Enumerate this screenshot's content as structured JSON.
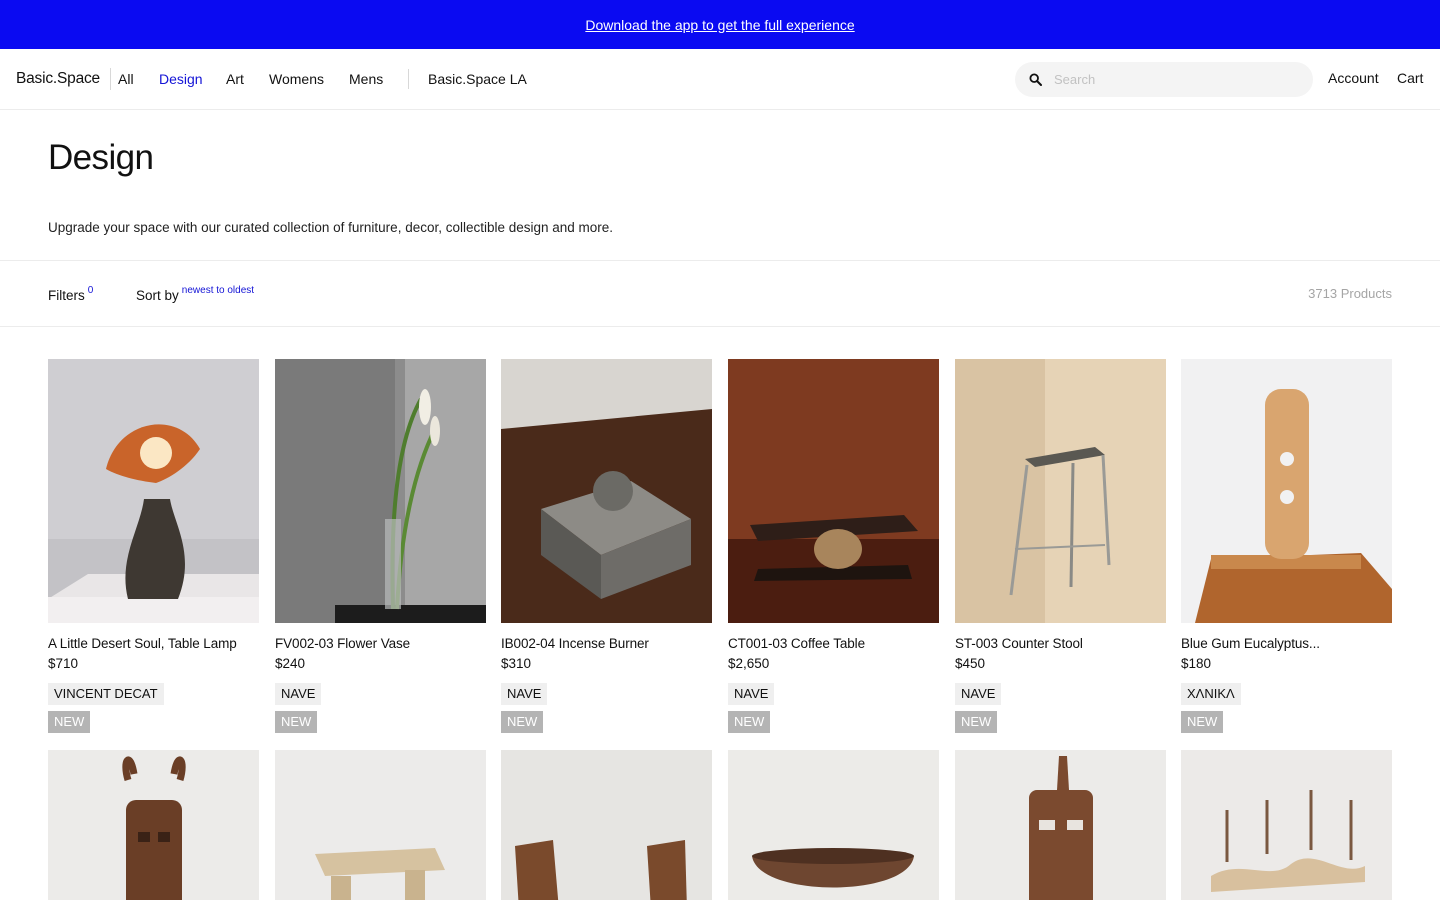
{
  "banner": {
    "text": "Download the app to get the full experience"
  },
  "nav": {
    "brand": "Basic.Space",
    "links": [
      {
        "label": "All",
        "active": false
      },
      {
        "label": "Design",
        "active": true
      },
      {
        "label": "Art",
        "active": false
      },
      {
        "label": "Womens",
        "active": false
      },
      {
        "label": "Mens",
        "active": false
      },
      {
        "label": "Basic.Space LA",
        "active": false
      }
    ],
    "search": {
      "placeholder": "Search",
      "value": ""
    },
    "account": "Account",
    "cart": "Cart"
  },
  "page": {
    "title": "Design",
    "description": "Upgrade your space with our curated collection of furniture, decor, collectible design and more."
  },
  "toolbar": {
    "filters_label": "Filters",
    "filters_count": "0",
    "sort_label": "Sort by",
    "sort_value": "newest to oldest",
    "product_count": "3713 Products"
  },
  "products": [
    {
      "name": "A Little Desert Soul, Table Lamp",
      "price": "$710",
      "brand": "VINCENT DECAT",
      "badge": "NEW",
      "image": "table-lamp"
    },
    {
      "name": "FV002-03 Flower Vase",
      "price": "$240",
      "brand": "NAVE",
      "badge": "NEW",
      "image": "flower-vase"
    },
    {
      "name": "IB002-04 Incense Burner",
      "price": "$310",
      "brand": "NAVE",
      "badge": "NEW",
      "image": "incense-burner"
    },
    {
      "name": "CT001-03 Coffee Table",
      "price": "$2,650",
      "brand": "NAVE",
      "badge": "NEW",
      "image": "coffee-table"
    },
    {
      "name": "ST-003 Counter Stool",
      "price": "$450",
      "brand": "NAVE",
      "badge": "NEW",
      "image": "counter-stool"
    },
    {
      "name": "Blue Gum Eucalyptus...",
      "price": "$180",
      "brand": "XΛNIKΛ",
      "badge": "NEW",
      "image": "eucalyptus-sculpture"
    }
  ],
  "products_row2": [
    {
      "image": "horned-mask"
    },
    {
      "image": "stone-stool"
    },
    {
      "image": "leather-chairs"
    },
    {
      "image": "wooden-bowl"
    },
    {
      "image": "tribal-mask"
    },
    {
      "image": "candelabra"
    }
  ],
  "colors": {
    "banner": "#0a0af2",
    "accent": "#1414d6",
    "badge_new": "#b4b4b4",
    "brand_tag": "#efefef"
  }
}
